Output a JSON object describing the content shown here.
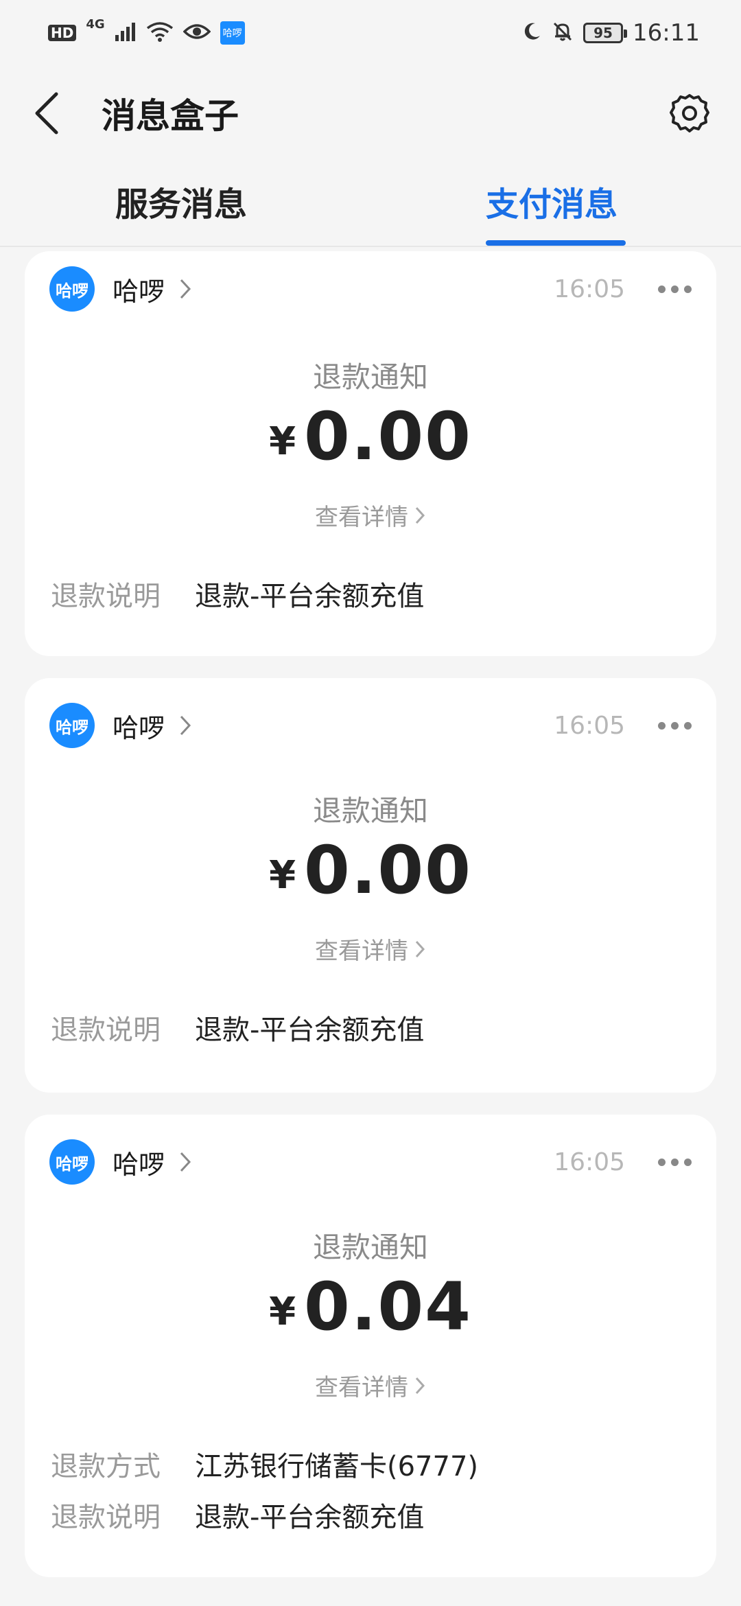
{
  "status_bar": {
    "hd": "HD",
    "network": "4G",
    "app_badge": "哈啰",
    "battery": "95",
    "time": "16:11"
  },
  "header": {
    "title": "消息盒子"
  },
  "tabs": [
    {
      "label": "服务消息",
      "active": false
    },
    {
      "label": "支付消息",
      "active": true
    }
  ],
  "cards": [
    {
      "avatar_text": "哈啰",
      "sender": "哈啰",
      "time": "16:05",
      "notice_title": "退款通知",
      "currency": "¥",
      "amount": "0.00",
      "detail_link": "查看详情",
      "rows": [
        {
          "key": "退款说明",
          "value": "退款-平台余额充值"
        }
      ]
    },
    {
      "avatar_text": "哈啰",
      "sender": "哈啰",
      "time": "16:05",
      "notice_title": "退款通知",
      "currency": "¥",
      "amount": "0.00",
      "detail_link": "查看详情",
      "rows": [
        {
          "key": "退款说明",
          "value": "退款-平台余额充值"
        }
      ]
    },
    {
      "avatar_text": "哈啰",
      "sender": "哈啰",
      "time": "16:05",
      "notice_title": "退款通知",
      "currency": "¥",
      "amount": "0.04",
      "detail_link": "查看详情",
      "rows": [
        {
          "key": "退款方式",
          "value": "江苏银行储蓄卡(6777)"
        },
        {
          "key": "退款说明",
          "value": "退款-平台余额充值"
        }
      ]
    }
  ],
  "colors": {
    "accent": "#1a6fe6",
    "brand": "#1a8cff",
    "background": "#f5f5f5"
  }
}
